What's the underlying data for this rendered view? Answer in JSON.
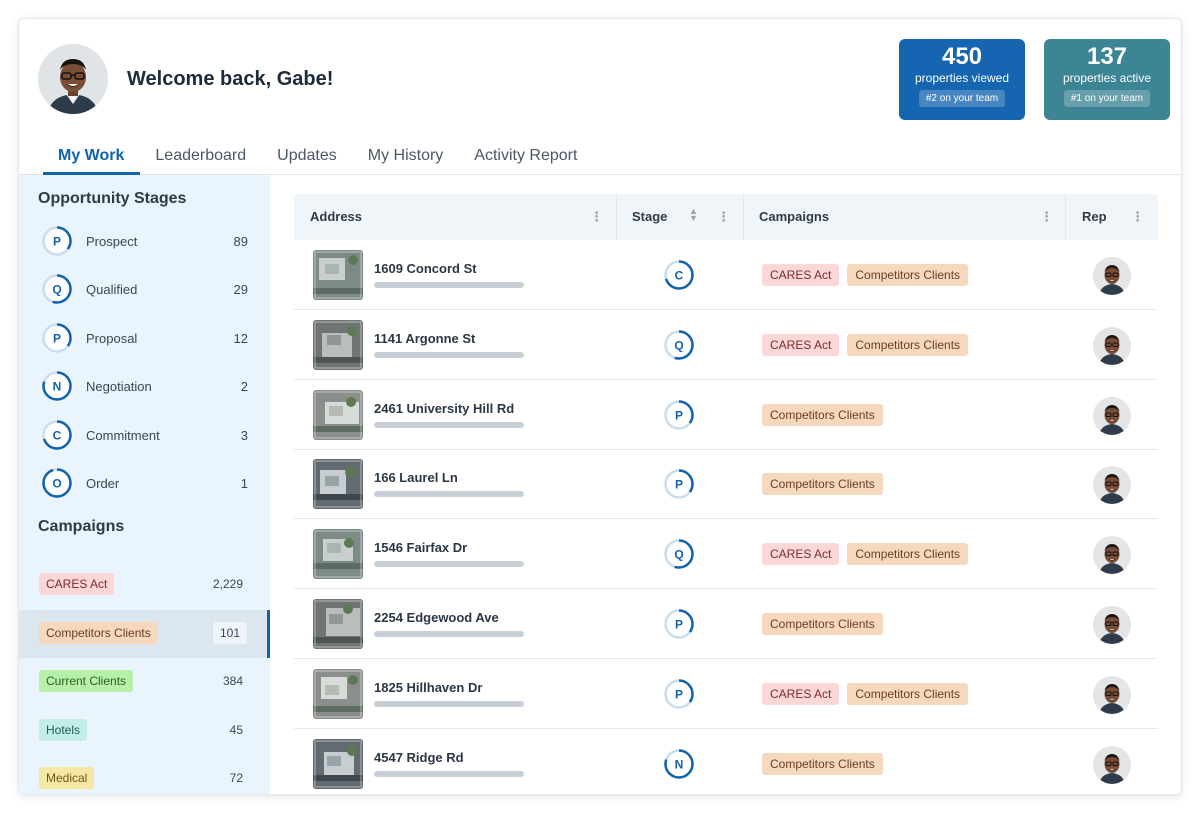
{
  "header": {
    "welcome": "Welcome back, Gabe!",
    "stats": [
      {
        "value": "450",
        "label": "properties viewed",
        "badge": "#2 on your team"
      },
      {
        "value": "137",
        "label": "properties active",
        "badge": "#1 on your team"
      }
    ]
  },
  "tabs": [
    "My Work",
    "Leaderboard",
    "Updates",
    "My History",
    "Activity Report"
  ],
  "sidebar": {
    "stages_title": "Opportunity Stages",
    "stages": [
      {
        "letter": "P",
        "name": "Prospect",
        "count": "89"
      },
      {
        "letter": "Q",
        "name": "Qualified",
        "count": "29"
      },
      {
        "letter": "P",
        "name": "Proposal",
        "count": "12"
      },
      {
        "letter": "N",
        "name": "Negotiation",
        "count": "2"
      },
      {
        "letter": "C",
        "name": "Commitment",
        "count": "3"
      },
      {
        "letter": "O",
        "name": "Order",
        "count": "1"
      }
    ],
    "campaigns_title": "Campaigns",
    "campaigns": [
      {
        "name": "CARES Act",
        "count": "2,229"
      },
      {
        "name": "Competitors Clients",
        "count": "101"
      },
      {
        "name": "Current Clients",
        "count": "384"
      },
      {
        "name": "Hotels",
        "count": "45"
      },
      {
        "name": "Medical",
        "count": "72"
      }
    ]
  },
  "table": {
    "headers": {
      "address": "Address",
      "stage": "Stage",
      "campaigns": "Campaigns",
      "rep": "Rep"
    },
    "rows": [
      {
        "address": "1609 Concord St",
        "stage": "C",
        "tags": [
          "CARES Act",
          "Competitors Clients"
        ]
      },
      {
        "address": "1141 Argonne St",
        "stage": "Q",
        "tags": [
          "CARES Act",
          "Competitors Clients"
        ]
      },
      {
        "address": "2461 University Hill Rd",
        "stage": "P",
        "tags": [
          "Competitors Clients"
        ]
      },
      {
        "address": "166 Laurel Ln",
        "stage": "P",
        "tags": [
          "Competitors Clients"
        ]
      },
      {
        "address": "1546 Fairfax Dr",
        "stage": "Q",
        "tags": [
          "CARES Act",
          "Competitors Clients"
        ]
      },
      {
        "address": "2254 Edgewood Ave",
        "stage": "P",
        "tags": [
          "Competitors Clients"
        ]
      },
      {
        "address": "1825 Hillhaven Dr",
        "stage": "P",
        "tags": [
          "CARES Act",
          "Competitors Clients"
        ]
      },
      {
        "address": "4547 Ridge Rd",
        "stage": "N",
        "tags": [
          "Competitors Clients"
        ]
      }
    ]
  },
  "colors": {
    "primary": "#1163ad",
    "stat_viewed": "#1565b0",
    "stat_active": "#3d8594",
    "sidebar_bg": "#eaf4fd"
  }
}
